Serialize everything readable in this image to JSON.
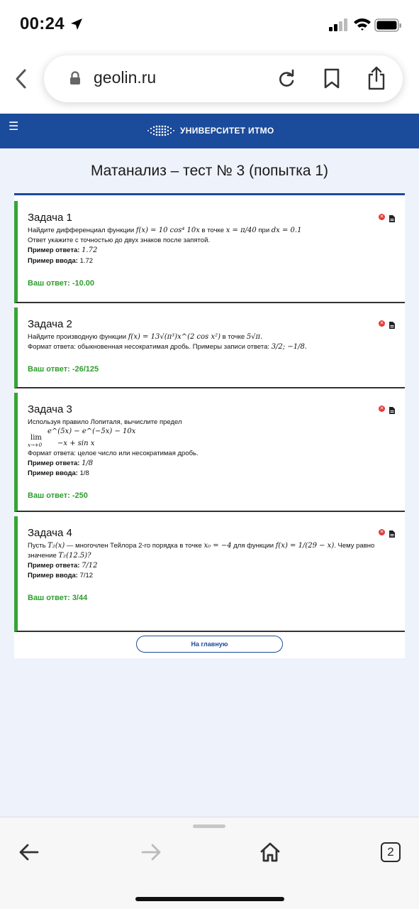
{
  "status_bar": {
    "time": "00:24",
    "icons": [
      "location-arrow-icon",
      "cellular-signal-icon",
      "wifi-icon",
      "battery-icon"
    ]
  },
  "browser": {
    "domain": "geolin.ru",
    "icons": [
      "back-chevron-icon",
      "lock-icon",
      "reload-icon",
      "bookmark-icon",
      "share-icon"
    ]
  },
  "site": {
    "brand": "УНИВЕРСИТЕТ ИТМО",
    "menu_icon": "☰",
    "title": "Матанализ – тест № 3 (попытка 1)",
    "colors": {
      "header": "#1b4b9b",
      "accent_green": "#35a534",
      "answer_green": "#2e9d2e",
      "error_red": "#e53935",
      "page_bg": "#eef2fa"
    }
  },
  "tasks": [
    {
      "title": "Задача 1",
      "line1_pre": "Найдите дифференциал функции ",
      "line1_math": "f(x) = 10 cos⁴ 10x",
      "line1_mid": " в точке ",
      "line1_math2": "x = π/40",
      "line1_mid2": " при ",
      "line1_math3": "dx = 0.1",
      "line2": "Ответ укажите с точностью до двух знаков после запятой.",
      "example_answer_label": "Пример ответа:",
      "example_answer": "1.72",
      "example_input_label": "Пример ввода:",
      "example_input": "1.72",
      "your_answer": "Ваш ответ: -10.00"
    },
    {
      "title": "Задача 2",
      "line1_pre": "Найдите производную функции ",
      "line1_math": "f(x) = 13√(π³)x^(2 cos x²)",
      "line1_mid": " в точке ",
      "line1_math2": "5√π.",
      "line2_pre": "Формат ответа: обыкновенная несократимая дробь. Примеры записи ответа: ",
      "line2_math": "3/2; −1/8.",
      "your_answer": "Ваш ответ: -26/125"
    },
    {
      "title": "Задача 3",
      "line1": "Используя правило Лопиталя, вычислите предел",
      "limit_numerator": "e^(5x) − e^(−5x) − 10x",
      "limit_lim": "lim",
      "limit_sub": "x→+0",
      "limit_denominator": "−x + sin x",
      "line2": "Формат ответа: целое число или несократимая дробь.",
      "example_answer_label": "Пример ответа:",
      "example_answer": "1/8",
      "example_input_label": "Пример ввода:",
      "example_input": "1/8",
      "your_answer": "Ваш ответ: -250"
    },
    {
      "title": "Задача 4",
      "line1_pre": "Пусть ",
      "line1_math": "T₂(x)",
      "line1_mid": " — многочлен Тейлора 2-го порядка в точке ",
      "line1_math2": "x₀ = −4",
      "line1_mid2": " для функции ",
      "line1_math3": "f(x) = 1/(29 − x)",
      "line1_post": ". Чему равно",
      "line2_pre": "значение ",
      "line2_math": "T₂(12.5)?",
      "example_answer_label": "Пример ответа:",
      "example_answer": "7/12",
      "example_input_label": "Пример ввода:",
      "example_input": "7/12",
      "your_answer": "Ваш ответ: 3/44"
    }
  ],
  "home_button": "На главную",
  "bottom_bar": {
    "tabs_count": "2",
    "icons": [
      "back-arrow-icon",
      "forward-arrow-icon",
      "home-icon",
      "tabs-icon"
    ]
  }
}
